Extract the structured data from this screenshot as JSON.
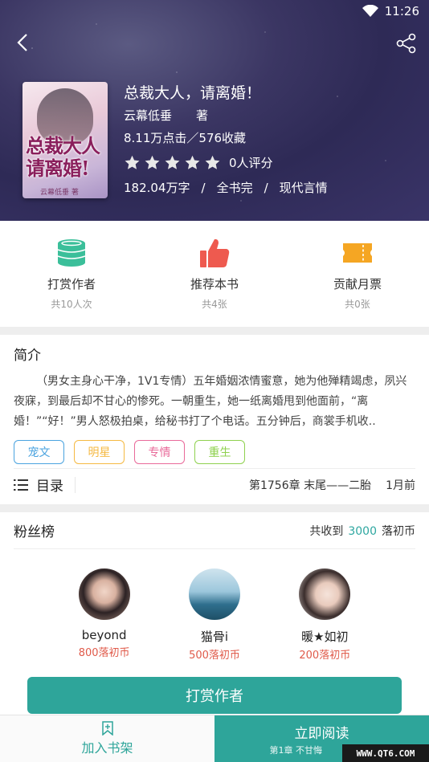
{
  "status_bar": {
    "time": "11:26"
  },
  "book": {
    "title": "总裁大人，请离婚！",
    "author": "云幕低垂",
    "author_suffix": "著",
    "stats": "8.11万点击／576收藏",
    "rating_text": "0人评分",
    "rating_stars": 0,
    "word_count": "182.04万字",
    "sep1": "/",
    "status": "全书完",
    "sep2": "/",
    "category": "现代言情",
    "cover_title": "总裁大人请离婚!",
    "cover_author": "云幕低垂 著"
  },
  "actions": [
    {
      "label": "打赏作者",
      "sub": "共10人次",
      "icon": "coins-icon",
      "color": "#3bbf9a"
    },
    {
      "label": "推荐本书",
      "sub": "共4张",
      "icon": "thumbs-up-icon",
      "color": "#ee5a4f"
    },
    {
      "label": "贡献月票",
      "sub": "共0张",
      "icon": "ticket-icon",
      "color": "#f5a623"
    }
  ],
  "intro": {
    "heading": "简介",
    "text": "（男女主身心干净，1V1专情）五年婚姻浓情蜜意，她为他殚精竭虑，夙兴夜寐，到最后却不甘心的惨死。一朝重生，她一纸离婚甩到他面前，“离婚！”“好！”男人怒极拍桌，给秘书打了个电话。五分钟后，商裳手机收..",
    "tags": [
      {
        "label": "宠文",
        "color": "#4aa3df"
      },
      {
        "label": "明星",
        "color": "#f5b942"
      },
      {
        "label": "专情",
        "color": "#e96a9a"
      },
      {
        "label": "重生",
        "color": "#8fd14f"
      }
    ]
  },
  "toc": {
    "label": "目录",
    "latest_chapter": "第1756章 末尾——二胎",
    "updated": "1月前"
  },
  "fans": {
    "heading": "粉丝榜",
    "total_prefix": "共收到",
    "total_amount": "3000",
    "total_unit": "落初币",
    "list": [
      {
        "name": "beyond",
        "coins": "800落初币"
      },
      {
        "name": "猫骨i",
        "coins": "500落初币"
      },
      {
        "name": "暖★如初",
        "coins": "200落初币"
      }
    ]
  },
  "reward_button": "打赏作者",
  "bottom_bar": {
    "add_shelf": "加入书架",
    "read_now": "立即阅读",
    "read_sub": "第1章 不甘悔"
  },
  "watermark": "WWW.QT6.COM",
  "colors": {
    "accent": "#2ea59a",
    "coin_red": "#e05a4a"
  }
}
